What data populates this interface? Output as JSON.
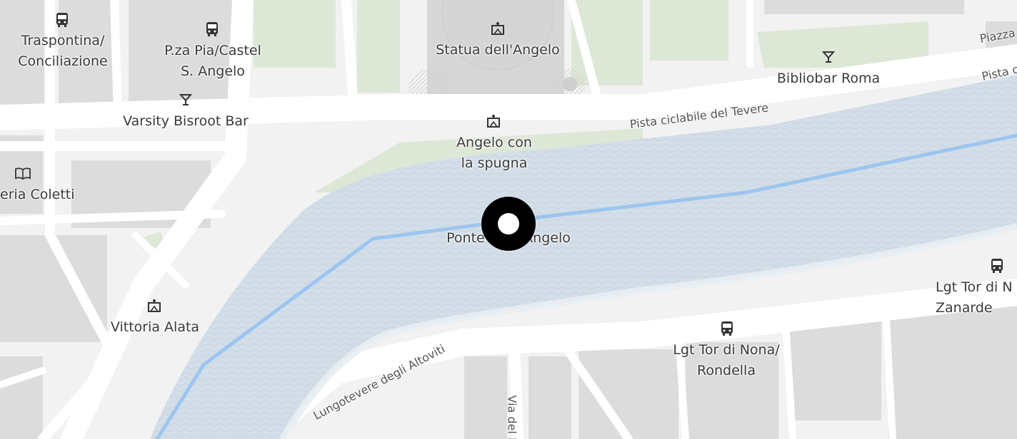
{
  "map": {
    "colors": {
      "land": "#f2f2f2",
      "blocks": "#dcdcdc",
      "roads": "#ffffff",
      "park": "#dde7d6",
      "water": "#d3dee8",
      "route": "#9cc5ef",
      "marker": "#000000"
    },
    "current_location": {
      "label": "Ponte Sant'Angelo",
      "icon": "location-pin-icon"
    },
    "pois": [
      {
        "id": "traspontina",
        "label": "Traspontina/\nConciliazione",
        "icon": "bus-stop-icon"
      },
      {
        "id": "pza-pia",
        "label": "P.za Pia/Castel\nS. Angelo",
        "icon": "bus-stop-icon"
      },
      {
        "id": "varsity",
        "label": "Varsity Bisroot Bar",
        "icon": "cocktail-bar-icon"
      },
      {
        "id": "statua",
        "label": "Statua dell'Angelo",
        "icon": "monument-icon"
      },
      {
        "id": "bibliobar",
        "label": "Bibliobar Roma",
        "icon": "cocktail-bar-icon"
      },
      {
        "id": "angelo-spugna",
        "label": "Angelo con\nla spugna",
        "icon": "monument-icon"
      },
      {
        "id": "libreria",
        "label": "eria Coletti",
        "icon": "bookstore-icon"
      },
      {
        "id": "vittoria",
        "label": "Vittoria Alata",
        "icon": "monument-icon"
      },
      {
        "id": "tor-nona-n",
        "label": "Lgt Tor di N\nZanarde",
        "icon": "bus-stop-icon"
      },
      {
        "id": "tor-nona-r",
        "label": "Lgt Tor di Nona/\nRondella",
        "icon": "bus-stop-icon"
      }
    ],
    "streets": {
      "pista_ciclabile": "Pista ciclabile del Tevere",
      "lungotevere": "Lungotevere degli Altoviti",
      "via_del_b": "Via del B",
      "piazza": "Piazza",
      "pista_c": "Pista c"
    }
  }
}
